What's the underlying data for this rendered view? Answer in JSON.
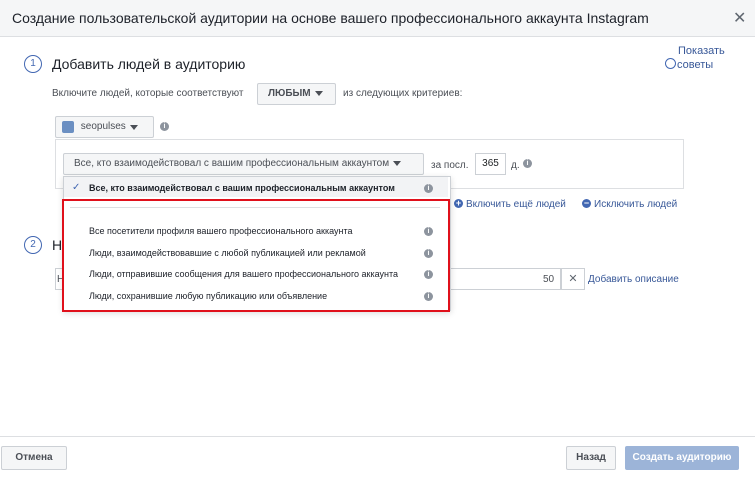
{
  "header": {
    "title": "Создание пользовательской аудитории на основе вашего профессионального аккаунта Instagram"
  },
  "tips": {
    "line1": "Показать",
    "line2": "советы"
  },
  "step1": {
    "number": "1",
    "title": "Добавить людей в аудиторию",
    "include_prefix": "Включите людей, которые соответствуют",
    "match_value": "ЛЮБЫМ",
    "include_suffix": "из следующих критериев:",
    "account": "seopulses"
  },
  "criteria": {
    "selected": "Все, кто взаимодействовал с вашим профессиональным аккаунтом",
    "period_label": "за посл.",
    "days": "365",
    "days_unit": "д."
  },
  "dropdown": {
    "checked": "Все, кто взаимодействовал с вашим профессиональным аккаунтом",
    "options": [
      "Все посетители профиля вашего профессионального аккаунта",
      "Люди, взаимодействовавшие с любой публикацией или рекламой",
      "Люди, отправившие сообщения для вашего профессионального аккаунта",
      "Люди, сохранившие любую публикацию или объявление"
    ]
  },
  "actions": {
    "include_more": "Включить ещё людей",
    "exclude": "Исключить людей"
  },
  "step2": {
    "number": "2",
    "title_fragment": "Н",
    "name_fragment": "Н",
    "char_count": "50",
    "add_description": "Добавить описание"
  },
  "footer": {
    "cancel": "Отмена",
    "back": "Назад",
    "create": "Создать аудиторию"
  },
  "colors": {
    "accent": "#4267b2",
    "highlight": "#e0101b",
    "disabled_button": "#9cb4d8"
  }
}
